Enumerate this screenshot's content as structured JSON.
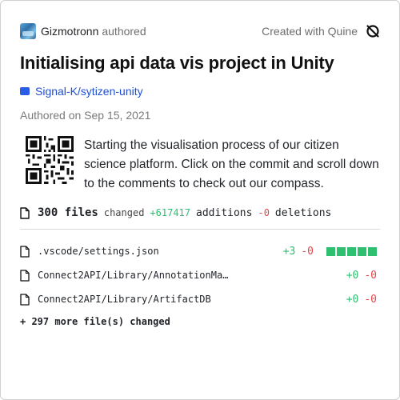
{
  "header": {
    "author_name": "Gizmotronn",
    "authored_word": "authored",
    "created_with": "Created with Quine"
  },
  "title": "Initialising api data vis project in Unity",
  "repo": {
    "name": "Signal-K/sytizen-unity"
  },
  "date": "Authored on Sep 15, 2021",
  "description": "Starting the visualisation process of our citizen science platform. Click on the commit and scroll down to the comments to check out our compass.",
  "summary": {
    "files_count": "300 files",
    "changed_label": "changed",
    "additions": "+617417",
    "additions_label": "additions",
    "deletions": "-0",
    "deletions_label": "deletions"
  },
  "files": [
    {
      "name": ".vscode/settings.json",
      "additions": "+3",
      "deletions": "-0",
      "add_blocks": 5,
      "total_blocks": 5
    },
    {
      "name": "Connect2API/Library/AnnotationMa…",
      "additions": "+0",
      "deletions": "-0"
    },
    {
      "name": "Connect2API/Library/ArtifactDB",
      "additions": "+0",
      "deletions": "-0"
    }
  ],
  "more_files": "+ 297 more file(s) changed",
  "colors": {
    "addition": "#2fbf71",
    "deletion": "#e5484d",
    "link": "#1f4fd1"
  },
  "icons": {
    "quine": "quine-logo-icon",
    "repo": "repository-icon",
    "file": "file-icon",
    "qr": "qr-code-icon"
  }
}
